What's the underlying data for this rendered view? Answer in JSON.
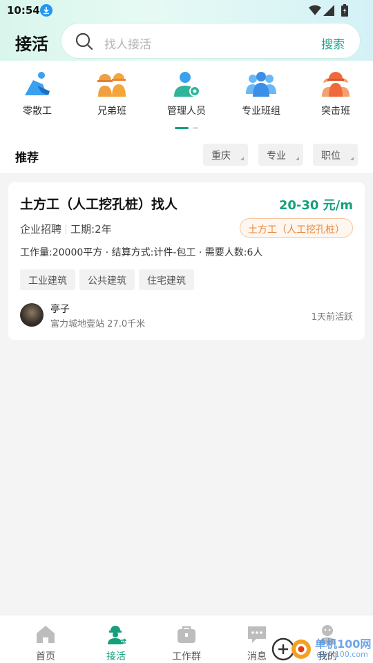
{
  "status": {
    "time": "10:54"
  },
  "header": {
    "title": "接活",
    "search_placeholder": "找人接活",
    "search_button": "搜索"
  },
  "categories": [
    {
      "label": "零散工",
      "icon": "worker-shovel-icon"
    },
    {
      "label": "兄弟班",
      "icon": "team-helmets-icon"
    },
    {
      "label": "管理人员",
      "icon": "manager-icon"
    },
    {
      "label": "专业班组",
      "icon": "professional-team-icon"
    },
    {
      "label": "突击班",
      "icon": "assault-team-icon"
    }
  ],
  "filters": {
    "title": "推荐",
    "chips": [
      "重庆",
      "专业",
      "职位"
    ]
  },
  "job": {
    "title": "土方工（人工挖孔桩）找人",
    "price": "20-30 元/m",
    "type": "企业招聘",
    "period": "工期:2年",
    "trade_tag": "土方工（人工挖孔桩）",
    "details": "工作量:20000平方 · 结算方式:计件-包工 · 需要人数:6人",
    "tags": [
      "工业建筑",
      "公共建筑",
      "住宅建筑"
    ],
    "user_name": "亭子",
    "user_location": "富力城地壹站",
    "distance": "27.0千米",
    "active": "1天前活跃"
  },
  "nav": [
    {
      "label": "首页",
      "icon": "home-icon"
    },
    {
      "label": "接活",
      "icon": "worker-icon"
    },
    {
      "label": "工作群",
      "icon": "briefcase-icon"
    },
    {
      "label": "消息",
      "icon": "message-icon"
    },
    {
      "label": "我的",
      "icon": "profile-icon"
    }
  ],
  "watermark": {
    "line1": "单机100网",
    "line2": "danji100.com"
  },
  "colors": {
    "accent": "#13a07b",
    "orange": "#e8883a",
    "blue": "#3aa0f0"
  }
}
